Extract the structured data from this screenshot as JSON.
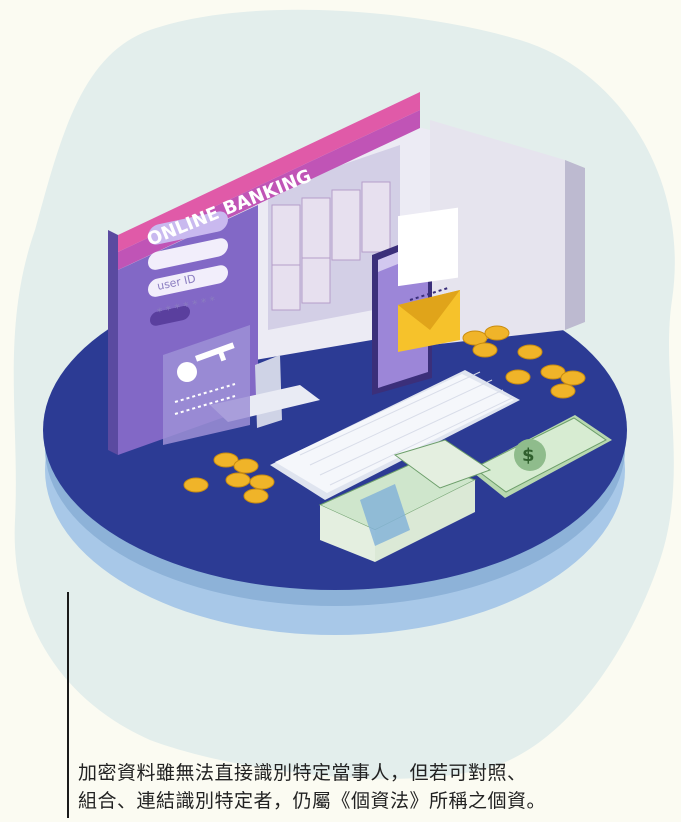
{
  "illustration": {
    "screen_banner": "ONLINE BANKING",
    "user_id_field": "user ID",
    "password_mask": "* * * * * * *",
    "phone_header": "",
    "colors": {
      "background": "#fbfbf2",
      "blob": "#e3eeec",
      "disc_top": "#2c3b94",
      "disc_side": "#a8c8e8",
      "screen_purple": "#8268c6",
      "banner_pink": "#e05aa8",
      "money_green": "#cfe6cc",
      "coin_gold": "#f0b429",
      "envelope_yellow": "#f6c22b"
    },
    "icons": [
      "key-icon",
      "coin-icon",
      "envelope-icon",
      "dollar-bill-icon",
      "safe-icon",
      "smartphone-icon",
      "keyboard-icon",
      "monitor-icon"
    ]
  },
  "caption": {
    "line1": "加密資料雖無法直接識別特定當事人，但若可對照、",
    "line2": "組合、連結識別特定者，仍屬《個資法》所稱之個資。"
  }
}
